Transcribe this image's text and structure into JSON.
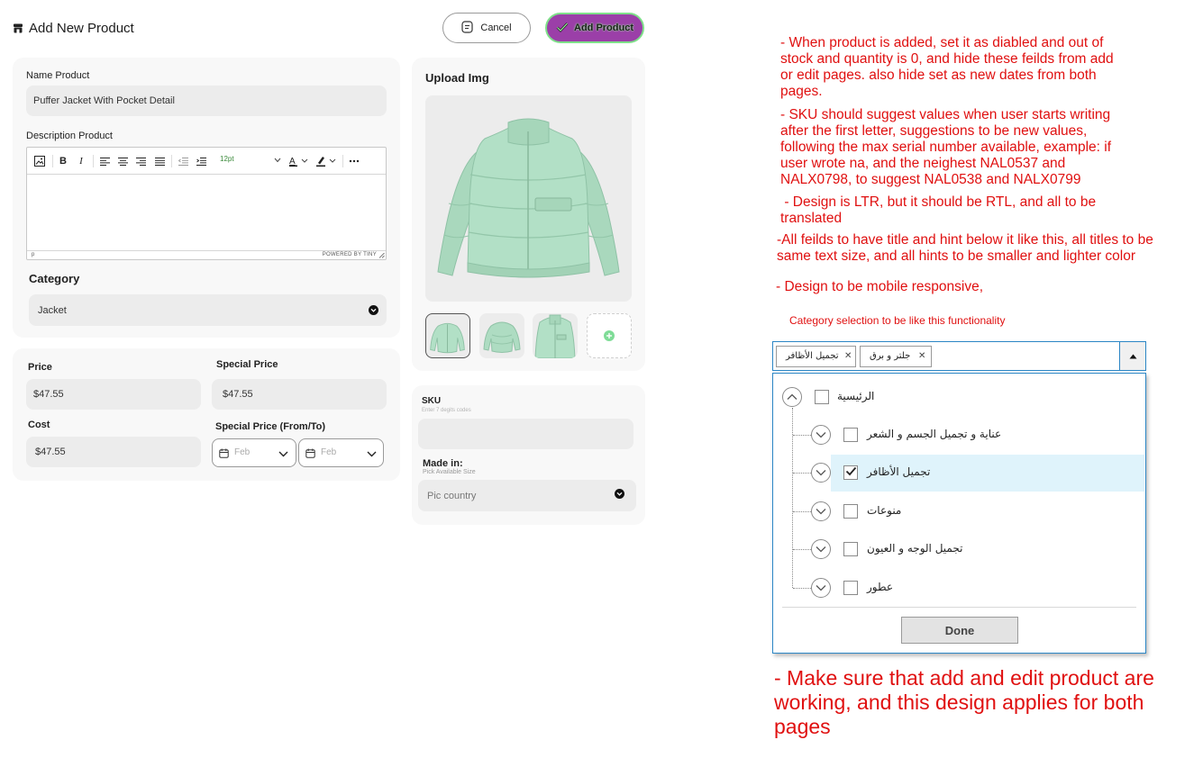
{
  "header": {
    "title": "Add New Product",
    "cancel_label": "Cancel",
    "add_label": "Add Product"
  },
  "product": {
    "name_label": "Name Product",
    "name_value": "Puffer Jacket With Pocket Detail",
    "description_label": "Description Product",
    "editor_status_left": "p",
    "editor_status_right": "POWERED BY TINY",
    "editor_fontsize": "12pt",
    "category_label": "Category",
    "category_value": "Jacket"
  },
  "pricing": {
    "price_label": "Price",
    "price_value": "$47.55",
    "special_price_label": "Special Price",
    "special_price_value": "$47.55",
    "cost_label": "Cost",
    "cost_value": "$47.55",
    "special_range_label": "Special Price (From/To)",
    "from_placeholder": "Feb",
    "to_placeholder": "Feb"
  },
  "upload": {
    "title": "Upload Img"
  },
  "sku": {
    "label": "SKU",
    "hint": "Enter 7 degits codes",
    "made_in_label": "Made in:",
    "made_in_hint": "Pick Available Size",
    "country_placeholder": "Pic country"
  },
  "notes": {
    "note1": "- When product is added, set it as diabled and out of stock and quantity is 0, and hide these feilds from add or edit pages. also hide set as new dates from both pages.",
    "note2": "- SKU should suggest values when user starts writing after the first letter, suggestions to be new values, following the max serial number available, example: if user wrote na, and the neighest NAL0537 and NALX0798, to suggest NAL0538 and NALX0799",
    "note3": " - Design is LTR, but it should be RTL, and all to be translated",
    "note4": "-All feilds to have title and hint below it like this, all titles to be same text size, and all hints to be smaller and lighter color",
    "note5": "- Design to be mobile responsive,",
    "note6": "Category selection to be like this functionality",
    "note7": "- Make sure that add and edit product are working, and this design applies for both pages"
  },
  "category_selector": {
    "chips": [
      "تجميل الأظافر",
      "جلتر و برق"
    ],
    "root_label": "الرئيسية",
    "items": [
      {
        "label": "عناية و تجميل الجسم و الشعر",
        "checked": false
      },
      {
        "label": "تجميل الأظافر",
        "checked": true
      },
      {
        "label": "منوعات",
        "checked": false
      },
      {
        "label": "تجميل الوجه و العيون",
        "checked": false
      },
      {
        "label": "عطور",
        "checked": false
      }
    ],
    "done_label": "Done"
  },
  "colors": {
    "accent_purple": "#9b3fa8",
    "accent_green": "#7fe08a",
    "note_red": "#e01010",
    "selected_row": "#dff3fb",
    "selector_border": "#2b86c5"
  },
  "icons": {
    "store": "store-icon",
    "cancel": "document-icon",
    "add": "check-icon",
    "dropdown": "chevron-down-icon",
    "calendar": "calendar-icon",
    "add_image": "plus-circle-icon"
  }
}
